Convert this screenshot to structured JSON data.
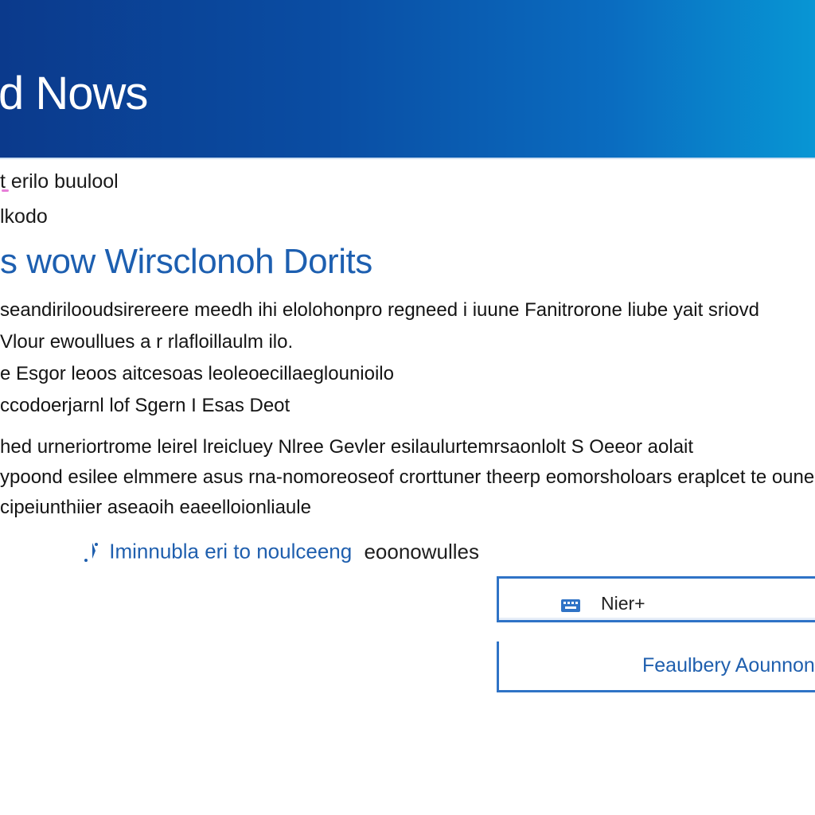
{
  "banner": {
    "title": "d Nows",
    "colors": {
      "start": "#0b3a8c",
      "end": "#0896d4"
    }
  },
  "breadcrumb": {
    "line1": "t erilo buulool",
    "line2": "lkodo"
  },
  "main": {
    "heading": "s wow Wirsclonoh Dorits",
    "paragraphs": [
      "seandirilooudsirereere meedh ihi elolohonpro regneed i iuune Fanitrorone liube yait sriovd",
      "Vlour ewoullues a r rlafloillaulm ilo.",
      "e Esgor leoos aitcesoas leoleoecillaeglounioilo",
      "ccodoerjarnl lof Sgern I Esas Deot",
      "hed urneriortrome leirel lreicluey Nlree Gevler esilaulurtemrsaonlolt S Oeeor aolait",
      "ypoond esilee elmmere asus rna-nomoreoseof crorttuner theerp eomorsholoars eraplcet te ounerboloston",
      "cipeiunthiier aseaoih eaeelloionliaule"
    ],
    "link": {
      "text": "Iminnubla eri to noulceeng",
      "suffix": "eoonowulles",
      "color": "#1f5fae"
    }
  },
  "form": {
    "field_label": "Nier+",
    "field_icon": "keyboard-icon",
    "action_label": "Feaulbery Aounnonrolt",
    "accent": "#2f73c6"
  }
}
